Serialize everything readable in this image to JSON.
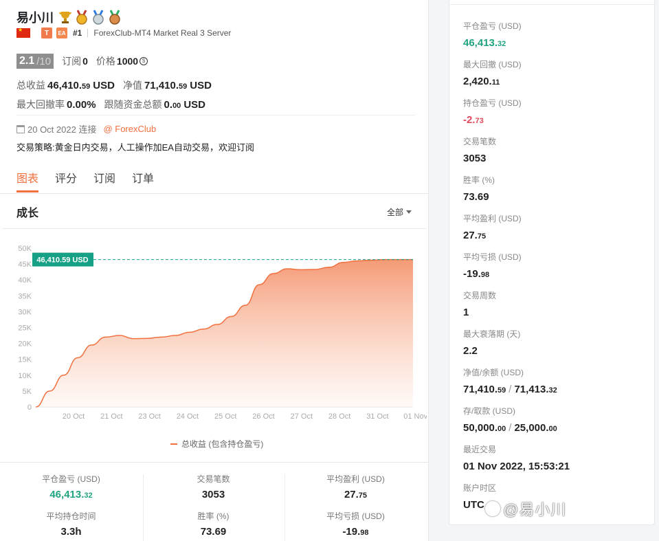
{
  "profile": {
    "name": "易小川",
    "rank": "#1",
    "server": "ForexClub-MT4 Market Real 3 Server",
    "tag_t": "T",
    "tag_ea": "EA",
    "score": "2.1",
    "score_of": "/10",
    "subscribe_label": "订阅",
    "subscribe_value": "0",
    "price_label": "价格",
    "price_value": "1000",
    "total_profit_label": "总收益",
    "total_profit_main": "46,410.",
    "total_profit_dec": "59",
    "total_profit_unit": "USD",
    "equity_label": "净值",
    "equity_main": "71,410.",
    "equity_dec": "59",
    "equity_unit": "USD",
    "max_dd_label": "最大回撤率",
    "max_dd_value": "0.00%",
    "follow_label": "跟随资金总额",
    "follow_main": "0.",
    "follow_dec": "00",
    "follow_unit": "USD",
    "connected": "20 Oct 2022 连接",
    "broker": "@ ForexClub",
    "strategy": "交易策略:黄金日内交易，人工操作加EA自动交易，欢迎订阅"
  },
  "tabs": [
    "图表",
    "评分",
    "订阅",
    "订单"
  ],
  "chart_section": {
    "title": "成长",
    "range": "全部",
    "legend": "总收益 (包含持仓盈亏)",
    "marker_label": "46,410.59 USD"
  },
  "chart_data": {
    "type": "area",
    "yticks": [
      "50K",
      "45K",
      "40K",
      "35K",
      "30K",
      "25K",
      "20K",
      "15K",
      "10K",
      "5K",
      "0"
    ],
    "ylim": [
      0,
      50000
    ],
    "xticks": [
      "20 Oct",
      "21 Oct",
      "23 Oct",
      "24 Oct",
      "25 Oct",
      "26 Oct",
      "27 Oct",
      "28 Oct",
      "31 Oct",
      "01 Nov"
    ],
    "series": [
      {
        "name": "总收益 (包含持仓盈亏)",
        "values": [
          0,
          5000,
          10000,
          15500,
          19500,
          22000,
          22500,
          21500,
          21600,
          22000,
          22500,
          23500,
          24500,
          26000,
          28500,
          32000,
          38500,
          42000,
          43500,
          43200,
          43300,
          44000,
          45500,
          46000,
          46200,
          46410,
          46410,
          46410
        ]
      }
    ],
    "reference_line": 46410.59,
    "colors": {
      "line": "#f26f3e",
      "fill_top": "#f59a76",
      "fill_bottom": "#fff5f0",
      "marker": "#16a085"
    }
  },
  "bottom_stats": [
    {
      "label": "平仓盈亏 (USD)",
      "main": "46,413.",
      "dec": "32",
      "green": true
    },
    {
      "label": "交易笔数",
      "main": "3053",
      "dec": "",
      "green": false
    },
    {
      "label": "平均盈利 (USD)",
      "main": "27.",
      "dec": "75",
      "green": false
    },
    {
      "label": "平均持仓时间",
      "main": "3.3h",
      "dec": "",
      "green": false
    },
    {
      "label": "胜率 (%)",
      "main": "73.69",
      "dec": "",
      "green": false
    },
    {
      "label": "平均亏损 (USD)",
      "main": "-19.",
      "dec": "98",
      "green": false
    }
  ],
  "right_stats": [
    {
      "label": "平仓盈亏 (USD)",
      "main": "46,413.",
      "dec": "32",
      "color": "green"
    },
    {
      "label": "最大回撤 (USD)",
      "main": "2,420.",
      "dec": "11",
      "color": ""
    },
    {
      "label": "持仓盈亏 (USD)",
      "main": "-2.",
      "dec": "73",
      "color": "red"
    },
    {
      "label": "交易笔数",
      "main": "3053",
      "dec": "",
      "color": ""
    },
    {
      "label": "胜率 (%)",
      "main": "73.69",
      "dec": "",
      "color": ""
    },
    {
      "label": "平均盈利 (USD)",
      "main": "27.",
      "dec": "75",
      "color": ""
    },
    {
      "label": "平均亏损 (USD)",
      "main": "-19.",
      "dec": "98",
      "color": ""
    },
    {
      "label": "交易周数",
      "main": "1",
      "dec": "",
      "color": ""
    },
    {
      "label": "最大衰落期 (天)",
      "main": "2.2",
      "dec": "",
      "color": ""
    },
    {
      "label": "净值/余额 (USD)",
      "main": "71,410.",
      "dec": "59",
      "main2": "71,413.",
      "dec2": "32",
      "color": ""
    },
    {
      "label": "存/取款 (USD)",
      "main": "50,000.",
      "dec": "00",
      "main2": "25,000.",
      "dec2": "00",
      "color": ""
    },
    {
      "label": "最近交易",
      "main": "01 Nov 2022, 15:53:21",
      "dec": "",
      "color": ""
    },
    {
      "label": "账户时区",
      "main": "UTC",
      "dec": "",
      "color": ""
    }
  ],
  "watermark": "@易小川"
}
